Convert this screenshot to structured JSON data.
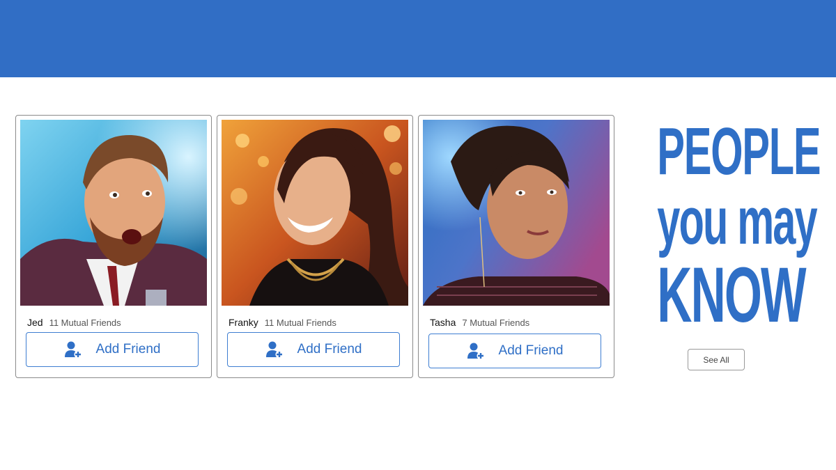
{
  "header": {
    "color": "#316ec5"
  },
  "cards": [
    {
      "name": "Jed",
      "mutual": "11 Mutual Friends",
      "button_label": "Add Friend",
      "photo": "man-with-beard-surprised"
    },
    {
      "name": "Franky",
      "mutual": "11 Mutual Friends",
      "button_label": "Add Friend",
      "photo": "woman-smiling-warm-lights"
    },
    {
      "name": "Tasha",
      "mutual": "7 Mutual Friends",
      "button_label": "Add Friend",
      "photo": "woman-serious-blue-lights"
    }
  ],
  "button_icon": "add-user-icon",
  "headline": {
    "line1": "PEOPLE",
    "line2": "you may",
    "line3": "KNOW"
  },
  "see_all_label": "See All",
  "colors": {
    "accent": "#2f6fc6",
    "border": "#8a8a8a"
  }
}
